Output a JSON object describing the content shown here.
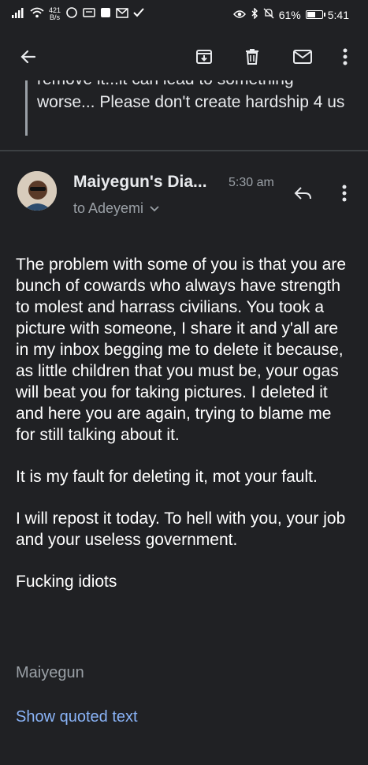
{
  "status_bar": {
    "net_speed_value": "421",
    "net_speed_unit": "B/s",
    "battery": "61%",
    "battery_level": 0.61,
    "time": "5:41"
  },
  "app_bar": {
    "back_icon": "arrow-back-icon",
    "archive_icon": "archive-icon",
    "delete_icon": "trash-icon",
    "mail_icon": "mail-icon",
    "overflow_icon": "more-vert-icon"
  },
  "previous_message": {
    "cut_line": "remove it...it can lead to something",
    "text": "worse... Please don't create hardship 4 us"
  },
  "message": {
    "sender": "Maiyegun's Dia...",
    "time": "5:30 am",
    "recipient": "to Adeyemi",
    "paragraphs": [
      "The problem with some of you is that you are bunch of cowards who always have strength to molest and harrass civilians. You took a picture with someone, I share it and y'all are in my inbox begging me to delete it because, as little children that you must be, your ogas will beat you for taking pictures. I deleted it and here you are again, trying to blame me for still talking about it.",
      "It is my fault for deleting it, mot your fault.",
      "I will repost it today. To hell with you, your job and your useless government.",
      "Fucking idiots"
    ],
    "signature": "Maiyegun",
    "show_quoted": "Show quoted text"
  },
  "colors": {
    "background": "#202124",
    "secondary_text": "#9aa0a6",
    "link": "#8ab4f8"
  }
}
